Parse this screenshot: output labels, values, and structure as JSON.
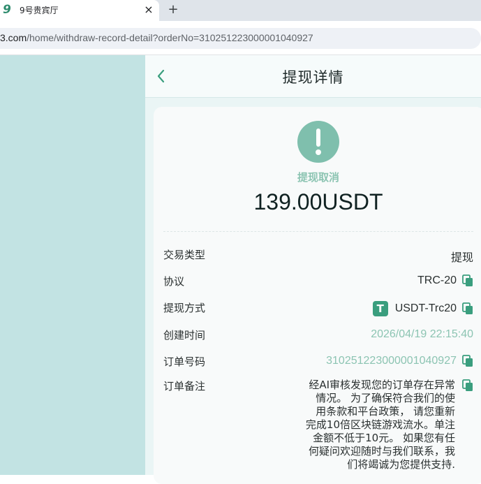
{
  "browser": {
    "tab_title": "9号贵宾厅",
    "tab_close": "×",
    "new_tab": "+",
    "url_host": "3.com",
    "url_path": "/home/withdraw-record-detail?orderNo=310251223000001040927"
  },
  "header": {
    "title": "提现详情",
    "back_icon": "chevron-left-icon"
  },
  "status": {
    "icon": "exclamation-circle-icon",
    "text": "提现取消",
    "color": "#7fbfad"
  },
  "amount": "139.00USDT",
  "details": {
    "type_label": "交易类型",
    "type_value": "提现",
    "protocol_label": "协议",
    "protocol_value": "TRC-20",
    "method_label": "提现方式",
    "method_value": "USDT-Trc20",
    "method_icon_text": "T",
    "created_label": "创建时间",
    "created_value": "2026/04/19 22:15:40",
    "order_label": "订单号码",
    "order_value": "310251223000001040927",
    "remark_label": "订单备注",
    "remark_lines": [
      "经AI审核发现您的订单存在异常",
      "情况。 为了确保符合我们的使",
      "用条款和平台政策， 请您重新",
      "完成10倍区块链游戏流水。单注",
      "金额不低于10元。 如果您有任",
      "何疑问欢迎随时与我们联系，我",
      "们将竭诚为您提供支持."
    ]
  },
  "colors": {
    "accent": "#7fbfad",
    "accent_text": "#8cc4b2",
    "side_panel": "#c2e3e3",
    "usdt": "#3a9e7e"
  }
}
